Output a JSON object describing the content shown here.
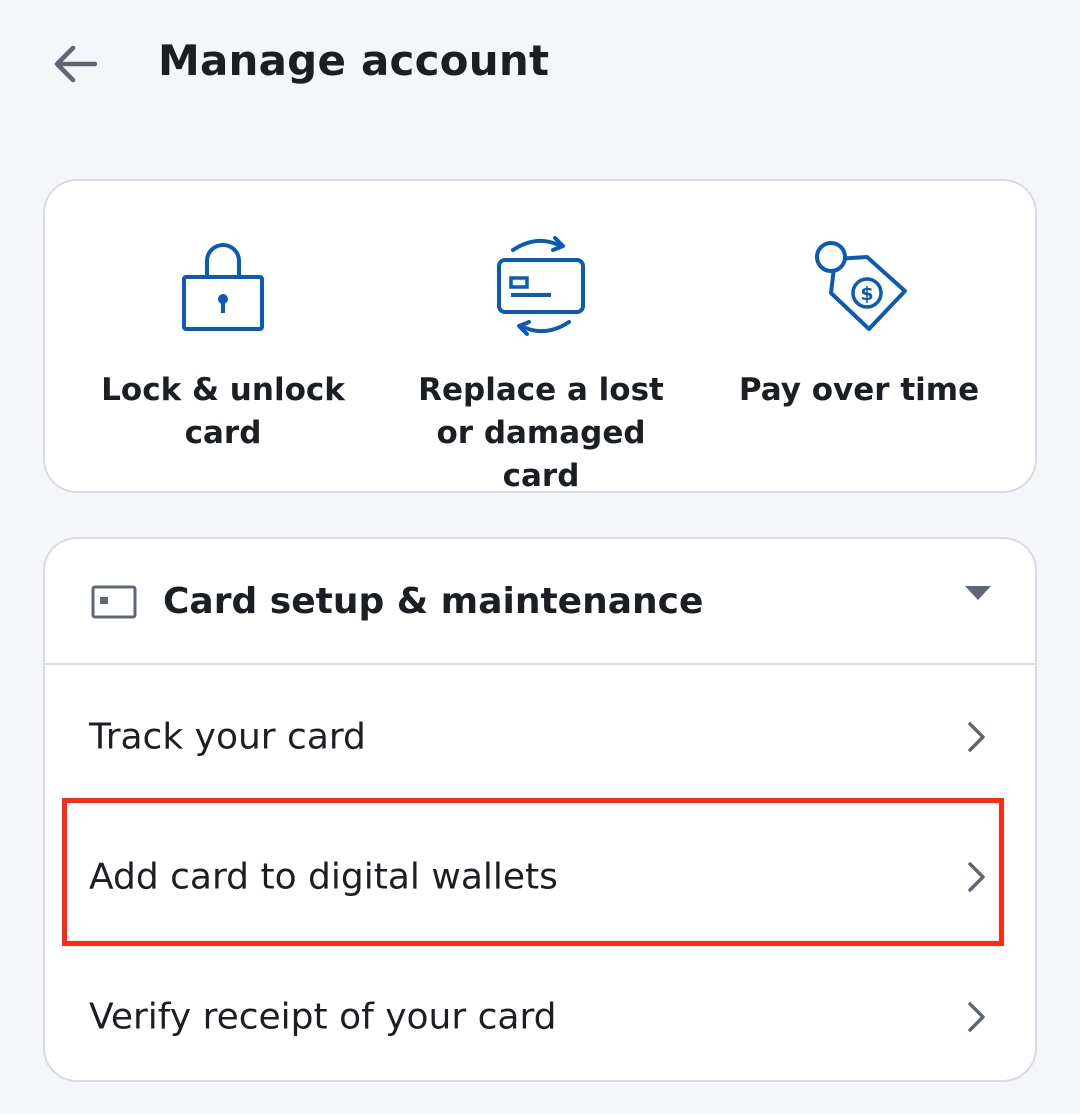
{
  "header": {
    "title": "Manage account",
    "back_icon": "arrow-left-icon"
  },
  "quick_actions": [
    {
      "label": "Lock & unlock card",
      "icon": "padlock-icon"
    },
    {
      "label": "Replace a lost or damaged card",
      "icon": "card-replace-icon"
    },
    {
      "label": "Pay over time",
      "icon": "price-tag-dollar-icon"
    }
  ],
  "section": {
    "title": "Card setup & maintenance",
    "icon": "card-outline-icon",
    "expanded": true,
    "items": [
      {
        "label": "Track your card"
      },
      {
        "label": "Add card to digital wallets",
        "highlighted": true
      },
      {
        "label": "Verify receipt of your card"
      }
    ]
  },
  "colors": {
    "accent": "#0a5bb5",
    "background": "#f5f6f9",
    "border": "#d7dbe1",
    "highlight": "#ff2a12",
    "icon_gray": "#5f6872"
  }
}
